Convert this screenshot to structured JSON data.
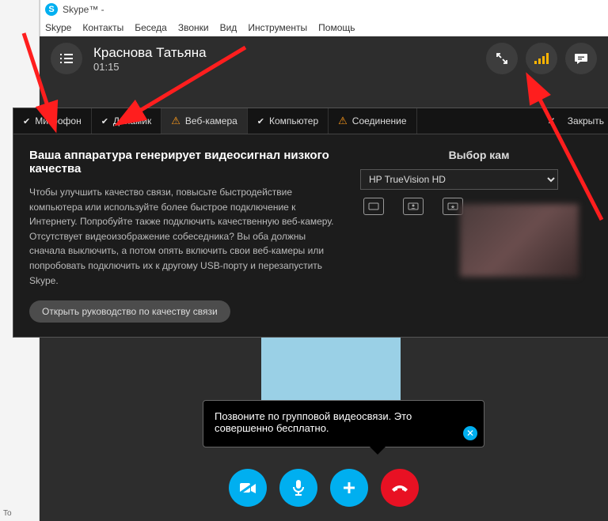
{
  "window": {
    "title": "Skype™ - "
  },
  "menu": {
    "skype": "Skype",
    "contacts": "Контакты",
    "conversation": "Беседа",
    "calls": "Звонки",
    "view": "Вид",
    "tools": "Инструменты",
    "help": "Помощь"
  },
  "call": {
    "name": "Краснова Татьяна",
    "duration": "01:15"
  },
  "tabs": {
    "mic": "Микрофон",
    "speaker": "Динамик",
    "webcam": "Веб-камера",
    "computer": "Компьютер",
    "connection": "Соединение",
    "close": "Закрыть"
  },
  "diag": {
    "heading": "Ваша аппаратура генерирует видеосигнал низкого качества",
    "body": "Чтобы улучшить качество связи, повысьте быстродействие компьютера или используйте более быстрое подключение к Интернету. Попробуйте также подключить качественную веб-камеру. Отсутствует видеоизображение собеседника? Вы оба должны сначала выключить, а потом опять включить свои веб-камеры или попробовать подключить их к другому USB-порту и перезапустить Skype.",
    "button": "Открыть руководство по качеству связи",
    "cam_title": "Выбор кам",
    "cam_selected": "HP TrueVision HD"
  },
  "balloon": {
    "text": "Позвоните по групповой видеосвязи. Это совершенно бесплатно."
  }
}
